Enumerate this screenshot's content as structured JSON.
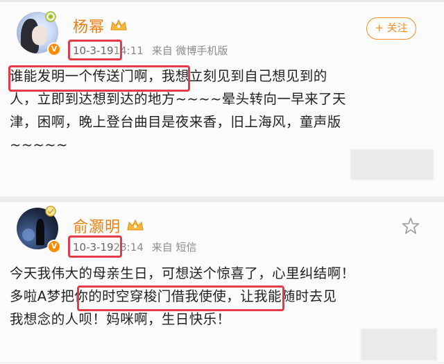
{
  "posts": [
    {
      "name": "杨幂",
      "date": "10-3-19",
      "time": "14:11",
      "source": "来自 微博手机版",
      "follow_label": "+ 关注",
      "lines": [
        "谁能发明一个传送门啊，我想立刻见到自己想见到的",
        "人，立即到达想到达的地方~~~~晕头转向一早来了天",
        "津，困啊，晚上登台曲目是夜来香，旧上海风，童声版",
        "~~~~~"
      ],
      "highlight": "谁能发明一个传送门啊，"
    },
    {
      "name": "俞灏明",
      "date": "10-3-19",
      "time": "23:14",
      "source": "来自 短信",
      "lines": [
        "今天我伟大的母亲生日，可想送个惊喜了，心里纠结啊！",
        "多啦A梦",
        "把你的时空穿梭门借我使使，",
        "让我能随时去见",
        "我想念的人呗！妈咪啊，生日快乐！"
      ],
      "highlight": "把你的时空穿梭门借我使使，"
    }
  ],
  "colors": {
    "name": "#eb7e10",
    "highlight_box": "#e23c49",
    "verified_badge": "#ff8a00",
    "follow_button": "#f28d2a"
  },
  "icons": {
    "verified": "verified-v-icon",
    "vip_crown": "crown-icon",
    "favorite": "star-icon"
  }
}
